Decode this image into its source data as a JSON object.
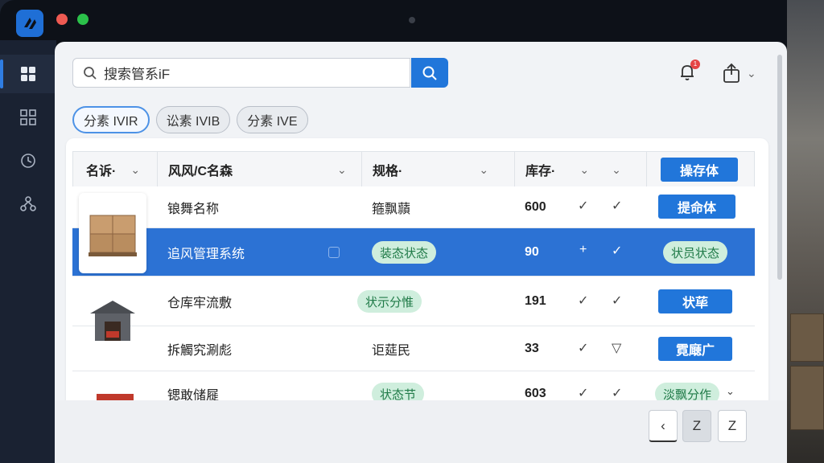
{
  "colors": {
    "accent": "#2176da",
    "selected_row": "#2c72d4",
    "pill_bg": "#cfeedd",
    "pill_text": "#1f7a47",
    "rail_bg": "#1a2232",
    "badge": "#e54545"
  },
  "sidebar": {
    "items": [
      {
        "icon": "dashboard-icon",
        "active": true
      },
      {
        "icon": "grid-icon",
        "active": false
      },
      {
        "icon": "clock-icon",
        "active": false
      },
      {
        "icon": "network-icon",
        "active": false
      }
    ]
  },
  "search": {
    "value": "搜索管系iF",
    "icon": "search-icon"
  },
  "header": {
    "notification_count": "1",
    "bell_icon": "bell-icon",
    "share_icon": "share-icon"
  },
  "chips": [
    {
      "label": "分素 IVIR",
      "active": true
    },
    {
      "label": "讼素 IVIB",
      "active": false
    },
    {
      "label": "分素 IVE",
      "active": false
    }
  ],
  "table": {
    "headers": {
      "name": "名诉·",
      "title": "风风/C名森",
      "spec": "规格·",
      "stock": "库存·",
      "action": "操存体"
    },
    "rows": [
      {
        "title": "锒舞名称",
        "spec": "箍飘蘏",
        "stock": "600",
        "action": "提命体"
      },
      {
        "title": "追风管理系统",
        "spec_pill": "装态状态",
        "stock": "90",
        "action_pill": "状员状态"
      },
      {
        "title": "仓库牢流敷",
        "spec_pill": "状示分惟",
        "stock": "191",
        "action": "状荜"
      },
      {
        "title": "拆觸究涮彪",
        "spec": "讵莚民",
        "stock": "33",
        "action": "霓廰广"
      },
      {
        "title": "锶敢储屣",
        "spec_pill": "状态节",
        "stock": "603",
        "action_pill": "淡飘分作"
      }
    ]
  },
  "pagination": {
    "prev": "‹",
    "pages": [
      "Z",
      "Z"
    ]
  }
}
